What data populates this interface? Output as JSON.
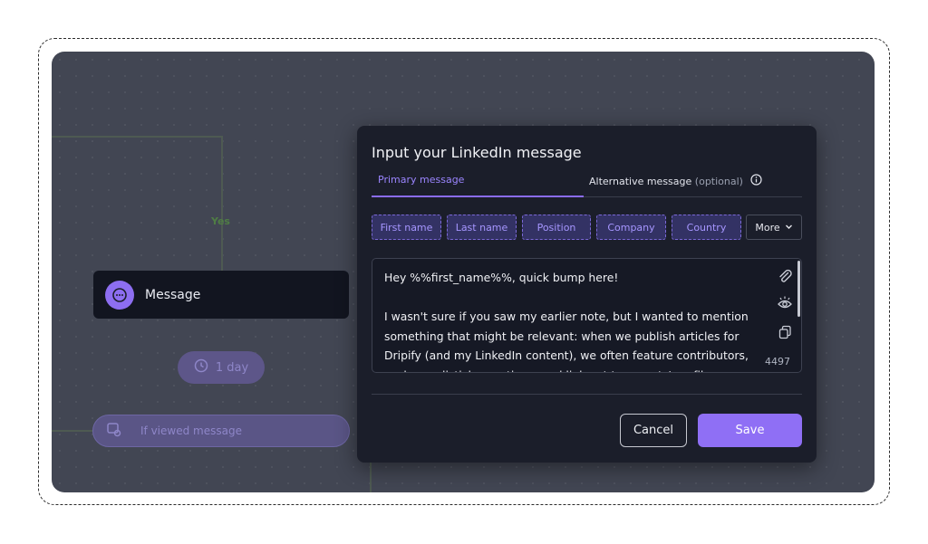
{
  "canvas": {
    "yes_label": "Yes",
    "node": {
      "label": "Message",
      "icon": "chat-bubble-icon"
    },
    "delay_pill": {
      "label": "1 day",
      "icon": "clock-icon"
    },
    "condition_pill": {
      "label": "If viewed message",
      "icon": "view-message-icon"
    }
  },
  "modal": {
    "title": "Input your LinkedIn message",
    "tabs": {
      "primary": "Primary message",
      "alternative": "Alternative message",
      "alternative_suffix": "(optional)",
      "info_icon": "info-icon"
    },
    "chips": [
      "First name",
      "Last name",
      "Position",
      "Company",
      "Country"
    ],
    "more_label": "More",
    "message_lines": [
      "Hey %%first_name%%, quick bump here!",
      "",
      " I wasn't sure if you saw my earlier note, but I wanted to mention",
      "something that might be relevant: when we publish articles for",
      "Dripify (and my LinkedIn content), we often feature contributors,",
      "exchange listicle mentions, and link out to experts' profiles or"
    ],
    "char_count": "4497",
    "side_icons": [
      "paperclip-icon",
      "preview-eye-icon",
      "copy-icon"
    ],
    "cancel_label": "Cancel",
    "save_label": "Save"
  },
  "colors": {
    "accent": "#8f6ff5",
    "modal_bg": "#1b1e2a",
    "canvas_bg": "#424653",
    "chip_bg": "#333264"
  }
}
